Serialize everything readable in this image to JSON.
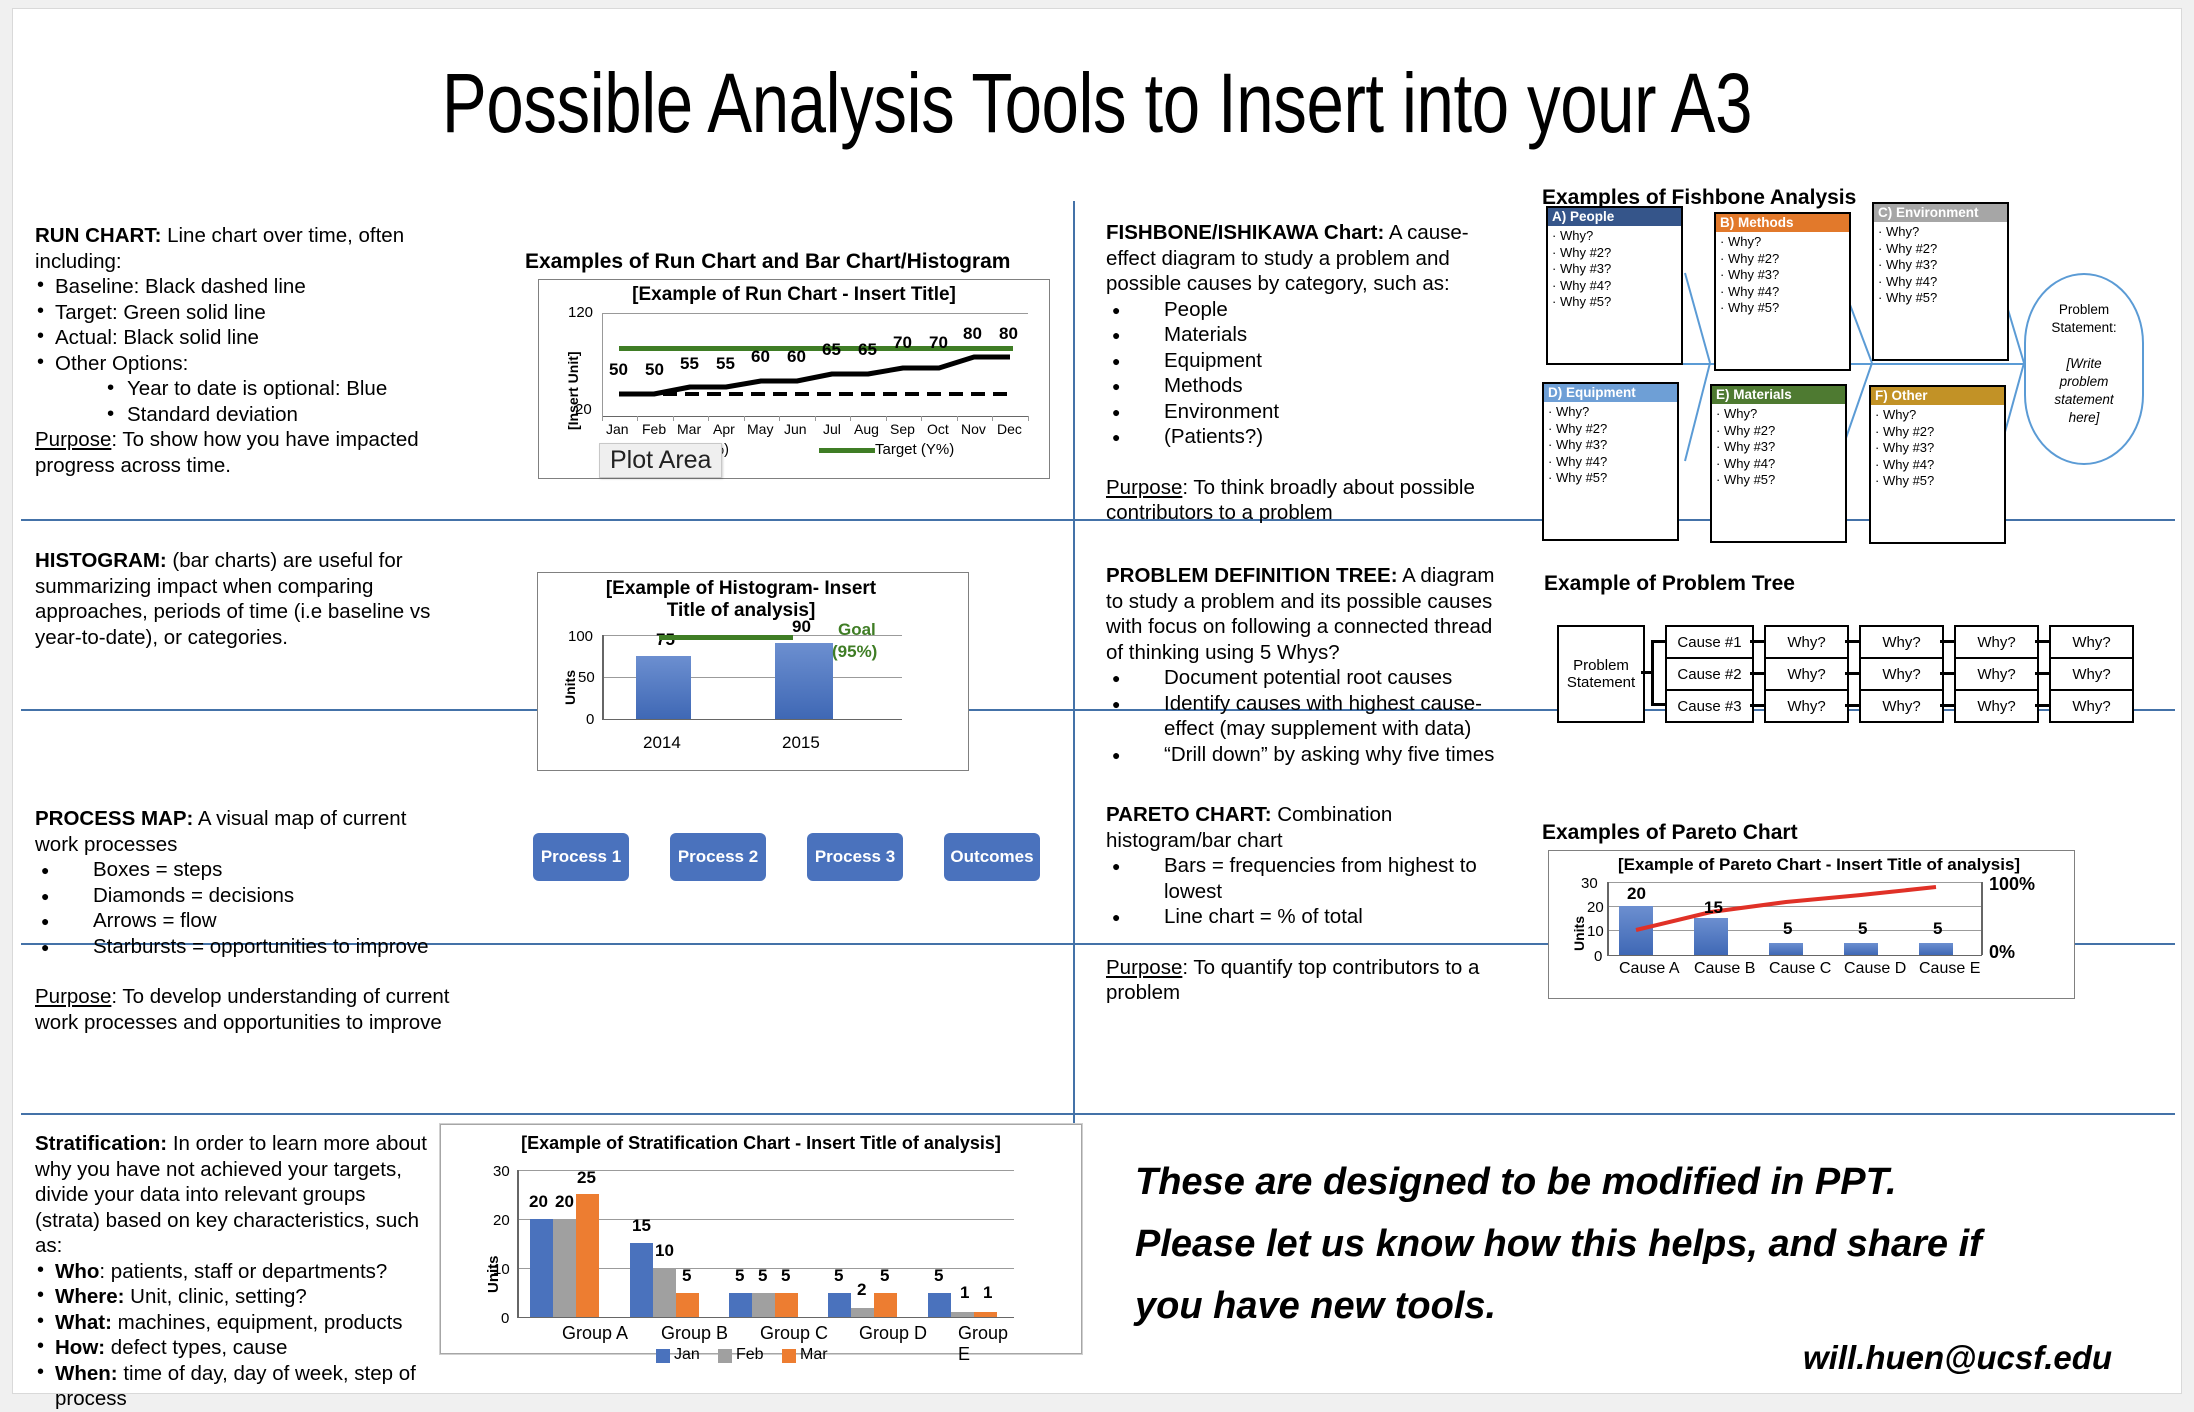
{
  "page": {
    "title": "Possible Analysis Tools to Insert into your A3",
    "accent_color": "#4472a8"
  },
  "sections": {
    "run_chart": {
      "heading": "RUN CHART:",
      "heading_rest": " Line chart over time, often including:",
      "bullets": [
        "Baseline: Black dashed line",
        "Target: Green solid line",
        "Actual: Black solid line",
        "Other Options:"
      ],
      "sub_bullets": [
        "Year to date is optional: Blue",
        "Standard deviation"
      ],
      "purpose_label": "Purpose",
      "purpose_text": ": To show how you have impacted progress across time.",
      "example_heading": "Examples of Run Chart and Bar Chart/Histogram",
      "plot_area_tooltip": "Plot Area"
    },
    "histogram": {
      "heading": "HISTOGRAM:",
      "heading_rest": " (bar charts) are useful for summarizing impact when comparing approaches, periods of time (i.e baseline vs year-to-date), or categories."
    },
    "process_map": {
      "heading": "PROCESS MAP:",
      "heading_rest": " A visual map of current work processes",
      "bullets": [
        "Boxes = steps",
        "Diamonds = decisions",
        "Arrows = flow",
        "Starbursts = opportunities to improve"
      ],
      "purpose_label": "Purpose",
      "purpose_text": ": To develop understanding of current work processes and opportunities to improve"
    },
    "stratification": {
      "heading": "Stratification:",
      "heading_rest": " In order to learn more about why you have not achieved your targets, divide your data into relevant groups (strata) based on key characteristics, such as:",
      "bullets": [
        {
          "label": "Who",
          "text": ": patients, staff or departments?"
        },
        {
          "label": "Where:",
          "text": " Unit, clinic, setting?"
        },
        {
          "label": "What:",
          "text": " machines, equipment, products"
        },
        {
          "label": "How:",
          "text": " defect types, cause"
        },
        {
          "label": "When:",
          "text": " time of day, day of week, step of process"
        }
      ]
    },
    "fishbone": {
      "heading": "FISHBONE/ISHIKAWA Chart:",
      "heading_rest": " A cause-effect diagram to study a problem and possible causes by category, such as:",
      "bullets": [
        "People",
        "Materials",
        "Equipment",
        "Methods",
        "Environment",
        "(Patients?)"
      ],
      "purpose_label": "Purpose",
      "purpose_text": ": To think broadly about possible contributors to a problem",
      "example_heading": "Examples of Fishbone Analysis",
      "boxes": [
        {
          "title": "A) People",
          "color": "#35558a",
          "whys": [
            "Why?",
            "Why #2?",
            "Why #3?",
            "Why #4?",
            "Why #5?"
          ]
        },
        {
          "title": "B) Methods",
          "color": "#e2792b",
          "whys": [
            "Why?",
            "Why #2?",
            "Why #3?",
            "Why #4?",
            "Why #5?"
          ]
        },
        {
          "title": "C) Environment",
          "color": "#a6a6a6",
          "whys": [
            "Why?",
            "Why #2?",
            "Why #3?",
            "Why #4?",
            "Why #5?"
          ]
        },
        {
          "title": "D) Equipment",
          "color": "#6e9fd6",
          "whys": [
            "Why?",
            "Why #2?",
            "Why #3?",
            "Why #4?",
            "Why #5?"
          ]
        },
        {
          "title": "E)  Materials",
          "color": "#4e7a31",
          "whys": [
            "Why?",
            "Why #2?",
            "Why #3?",
            "Why #4?",
            "Why #5?"
          ]
        },
        {
          "title": "F) Other",
          "color": "#c29226",
          "whys": [
            "Why?",
            "Why #2?",
            "Why #3?",
            "Why #4?",
            "Why #5?"
          ]
        }
      ],
      "problem_oval": {
        "line1": "Problem",
        "line2": "Statement:",
        "line3": "[Write",
        "line4": "problem",
        "line5": "statement",
        "line6": "here]"
      }
    },
    "problem_tree": {
      "heading": "PROBLEM DEFINITION TREE:",
      "heading_rest": " A diagram to study a problem and its possible causes with focus on following a connected thread of thinking using 5 Whys?",
      "bullets": [
        "Document potential root causes",
        "Identify causes with highest cause-effect (may supplement with data)",
        "“Drill down” by asking why five times"
      ],
      "example_heading": "Example of Problem Tree",
      "root_line1": "Problem",
      "root_line2": "Statement",
      "rows": [
        {
          "cause": "Cause #1",
          "whys": [
            "Why?",
            "Why?",
            "Why?",
            "Why?"
          ]
        },
        {
          "cause": "Cause #2",
          "whys": [
            "Why?",
            "Why?",
            "Why?",
            "Why?"
          ]
        },
        {
          "cause": "Cause #3",
          "whys": [
            "Why?",
            "Why?",
            "Why?",
            "Why?"
          ]
        }
      ]
    },
    "pareto": {
      "heading": "PARETO CHART:",
      "heading_rest": " Combination histogram/bar chart",
      "bullets": [
        "Bars = frequencies from highest to lowest",
        "Line chart = % of total"
      ],
      "purpose_label": "Purpose",
      "purpose_text": ": To quantify top contributors to a problem",
      "example_heading": "Examples of Pareto Chart"
    },
    "process_steps": [
      "Process 1",
      "Process 2",
      "Process 3",
      "Outcomes"
    ],
    "closing": {
      "line1": "These are designed to be modified in PPT.",
      "line2": "Please let us know how this helps, and share if",
      "line3": "you have new tools.",
      "email": "will.huen@ucsf.edu"
    }
  },
  "chart_data": [
    {
      "type": "line",
      "name": "run-chart",
      "title": "[Example of Run Chart - Insert Title]",
      "ylabel": "[Insert Unit]",
      "xlabel": "",
      "ylim": [
        20,
        120
      ],
      "yticks": [
        20,
        120
      ],
      "categories": [
        "Jan",
        "Feb",
        "Mar",
        "Apr",
        "May",
        "Jun",
        "Jul",
        "Aug",
        "Sep",
        "Oct",
        "Nov",
        "Dec"
      ],
      "series": [
        {
          "name": "Actual",
          "style": "black solid line",
          "values": [
            50,
            50,
            55,
            55,
            60,
            60,
            65,
            65,
            70,
            70,
            80,
            80
          ],
          "data_labels": [
            "50",
            "50",
            "55",
            "55",
            "60",
            "60",
            "65",
            "65",
            "70",
            "70",
            "80",
            "80"
          ]
        },
        {
          "name": "Baseline (X%)",
          "style": "black dashed line",
          "values": [
            47,
            47,
            47,
            47,
            47,
            47,
            47,
            47,
            47,
            47,
            47,
            47
          ]
        },
        {
          "name": "Target (Y%)",
          "style": "green solid line",
          "color": "#3f7d25",
          "values": [
            85,
            85,
            85,
            85,
            85,
            85,
            85,
            85,
            85,
            85,
            85,
            85
          ]
        }
      ],
      "legend": [
        "Baseline (X%)",
        "Target (Y%)"
      ],
      "legend_position": "bottom",
      "grid": false
    },
    {
      "type": "bar",
      "name": "histogram-chart",
      "title": "[Example of Histogram- Insert Title of analysis]",
      "ylabel": "Units",
      "categories": [
        "2014",
        "2015"
      ],
      "values": [
        75,
        90
      ],
      "data_labels": [
        "75",
        "90"
      ],
      "ylim": [
        0,
        100
      ],
      "yticks": [
        0,
        50,
        100
      ],
      "goal_label": "Goal",
      "goal_value_label": "(95%)",
      "goal_line": 95,
      "goal_color": "#3f7d25",
      "bar_color": "#4a72bd",
      "grid": true
    },
    {
      "type": "bar",
      "name": "pareto-chart",
      "title": "[Example of Pareto Chart - Insert Title of analysis]",
      "ylabel": "Units",
      "categories": [
        "Cause A",
        "Cause B",
        "Cause C",
        "Cause D",
        "Cause E"
      ],
      "values": [
        20,
        15,
        5,
        5,
        5
      ],
      "data_labels": [
        "20",
        "15",
        "5",
        "5",
        "5"
      ],
      "ylim": [
        0,
        30
      ],
      "yticks": [
        0,
        10,
        20,
        30
      ],
      "secondary_axis": {
        "label_top": "100%",
        "label_bottom": "0%",
        "values": [
          40,
          70,
          82,
          92,
          100
        ],
        "color": "#e03127"
      },
      "bar_color": "#4a72bd",
      "grid": true
    },
    {
      "type": "bar",
      "name": "stratification-chart",
      "title": "[Example of Stratification Chart - Insert Title of analysis]",
      "ylabel": "Units",
      "categories": [
        "Group A",
        "Group B",
        "Group C",
        "Group D",
        "Group E"
      ],
      "series": [
        {
          "name": "Jan",
          "color": "#4a72bd",
          "values": [
            20,
            15,
            5,
            5,
            5
          ]
        },
        {
          "name": "Feb",
          "color": "#a0a0a0",
          "values": [
            20,
            10,
            5,
            2,
            1
          ]
        },
        {
          "name": "Mar",
          "color": "#ed7d31",
          "values": [
            25,
            5,
            5,
            5,
            1
          ]
        }
      ],
      "ylim": [
        0,
        30
      ],
      "yticks": [
        0,
        10,
        20,
        30
      ],
      "legend": [
        "Jan",
        "Feb",
        "Mar"
      ],
      "legend_position": "bottom",
      "grid": true
    }
  ]
}
